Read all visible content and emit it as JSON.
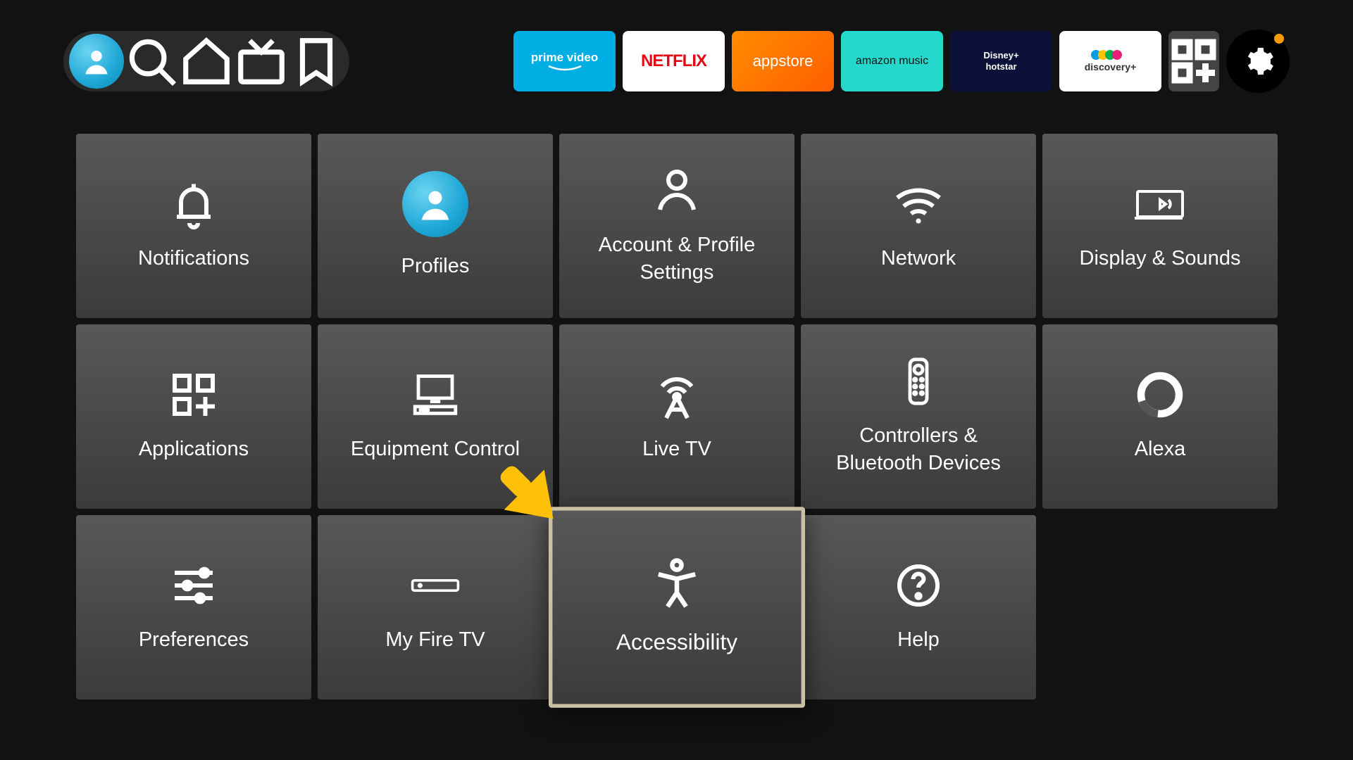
{
  "topbar": {
    "apps": [
      {
        "id": "prime",
        "label": "prime video"
      },
      {
        "id": "netflix",
        "label": "NETFLIX"
      },
      {
        "id": "appstore",
        "label": "appstore"
      },
      {
        "id": "music",
        "label": "amazon music"
      },
      {
        "id": "hotstar",
        "label_top": "Disney+",
        "label_bottom": "hotstar"
      },
      {
        "id": "discovery",
        "label": "discovery+"
      }
    ]
  },
  "settings": {
    "tiles": [
      {
        "id": "notifications",
        "label": "Notifications"
      },
      {
        "id": "profiles",
        "label": "Profiles"
      },
      {
        "id": "account",
        "label": "Account & Profile Settings"
      },
      {
        "id": "network",
        "label": "Network"
      },
      {
        "id": "display",
        "label": "Display & Sounds"
      },
      {
        "id": "applications",
        "label": "Applications"
      },
      {
        "id": "equipment",
        "label": "Equipment Control"
      },
      {
        "id": "livetv",
        "label": "Live TV"
      },
      {
        "id": "controllers",
        "label": "Controllers & Bluetooth Devices"
      },
      {
        "id": "alexa",
        "label": "Alexa"
      },
      {
        "id": "preferences",
        "label": "Preferences"
      },
      {
        "id": "myfiretv",
        "label": "My Fire TV"
      },
      {
        "id": "accessibility",
        "label": "Accessibility",
        "selected": true
      },
      {
        "id": "help",
        "label": "Help"
      }
    ]
  }
}
